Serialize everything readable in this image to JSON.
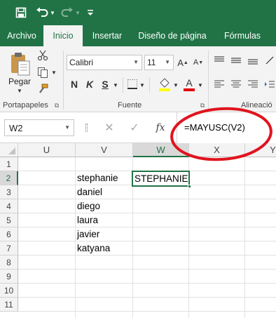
{
  "qat": {
    "save_icon": "save-icon",
    "undo_icon": "undo-icon",
    "redo_icon": "redo-icon",
    "customize_icon": "customize-qat-icon"
  },
  "tabs": [
    {
      "label": "Archivo"
    },
    {
      "label": "Inicio"
    },
    {
      "label": "Insertar"
    },
    {
      "label": "Diseño de página"
    },
    {
      "label": "Fórmulas"
    }
  ],
  "ribbon": {
    "clipboard": {
      "paste_label": "Pegar",
      "group_label": "Portapapeles"
    },
    "font": {
      "font_name": "Calibri",
      "font_size": "11",
      "bold": "N",
      "italic": "K",
      "underline": "S",
      "group_label": "Fuente"
    },
    "alignment": {
      "group_label": "Alineació"
    }
  },
  "formula_bar": {
    "name_box": "W2",
    "fx_label": "fx",
    "formula": "=MAYUSC(V2)"
  },
  "grid": {
    "columns": [
      "U",
      "V",
      "W",
      "X",
      "Y"
    ],
    "rows": [
      "1",
      "2",
      "3",
      "4",
      "5",
      "6",
      "7",
      "8",
      "9",
      "10",
      "11"
    ],
    "active_cell": "W2",
    "cells": {
      "V2": "stephanie",
      "W2": "STEPHANIE",
      "V3": "daniel",
      "V4": "diego",
      "V5": "laura",
      "V6": "javier",
      "V7": "katyana"
    }
  },
  "colors": {
    "excel_green": "#217346",
    "annotation_red": "#e0141e"
  }
}
